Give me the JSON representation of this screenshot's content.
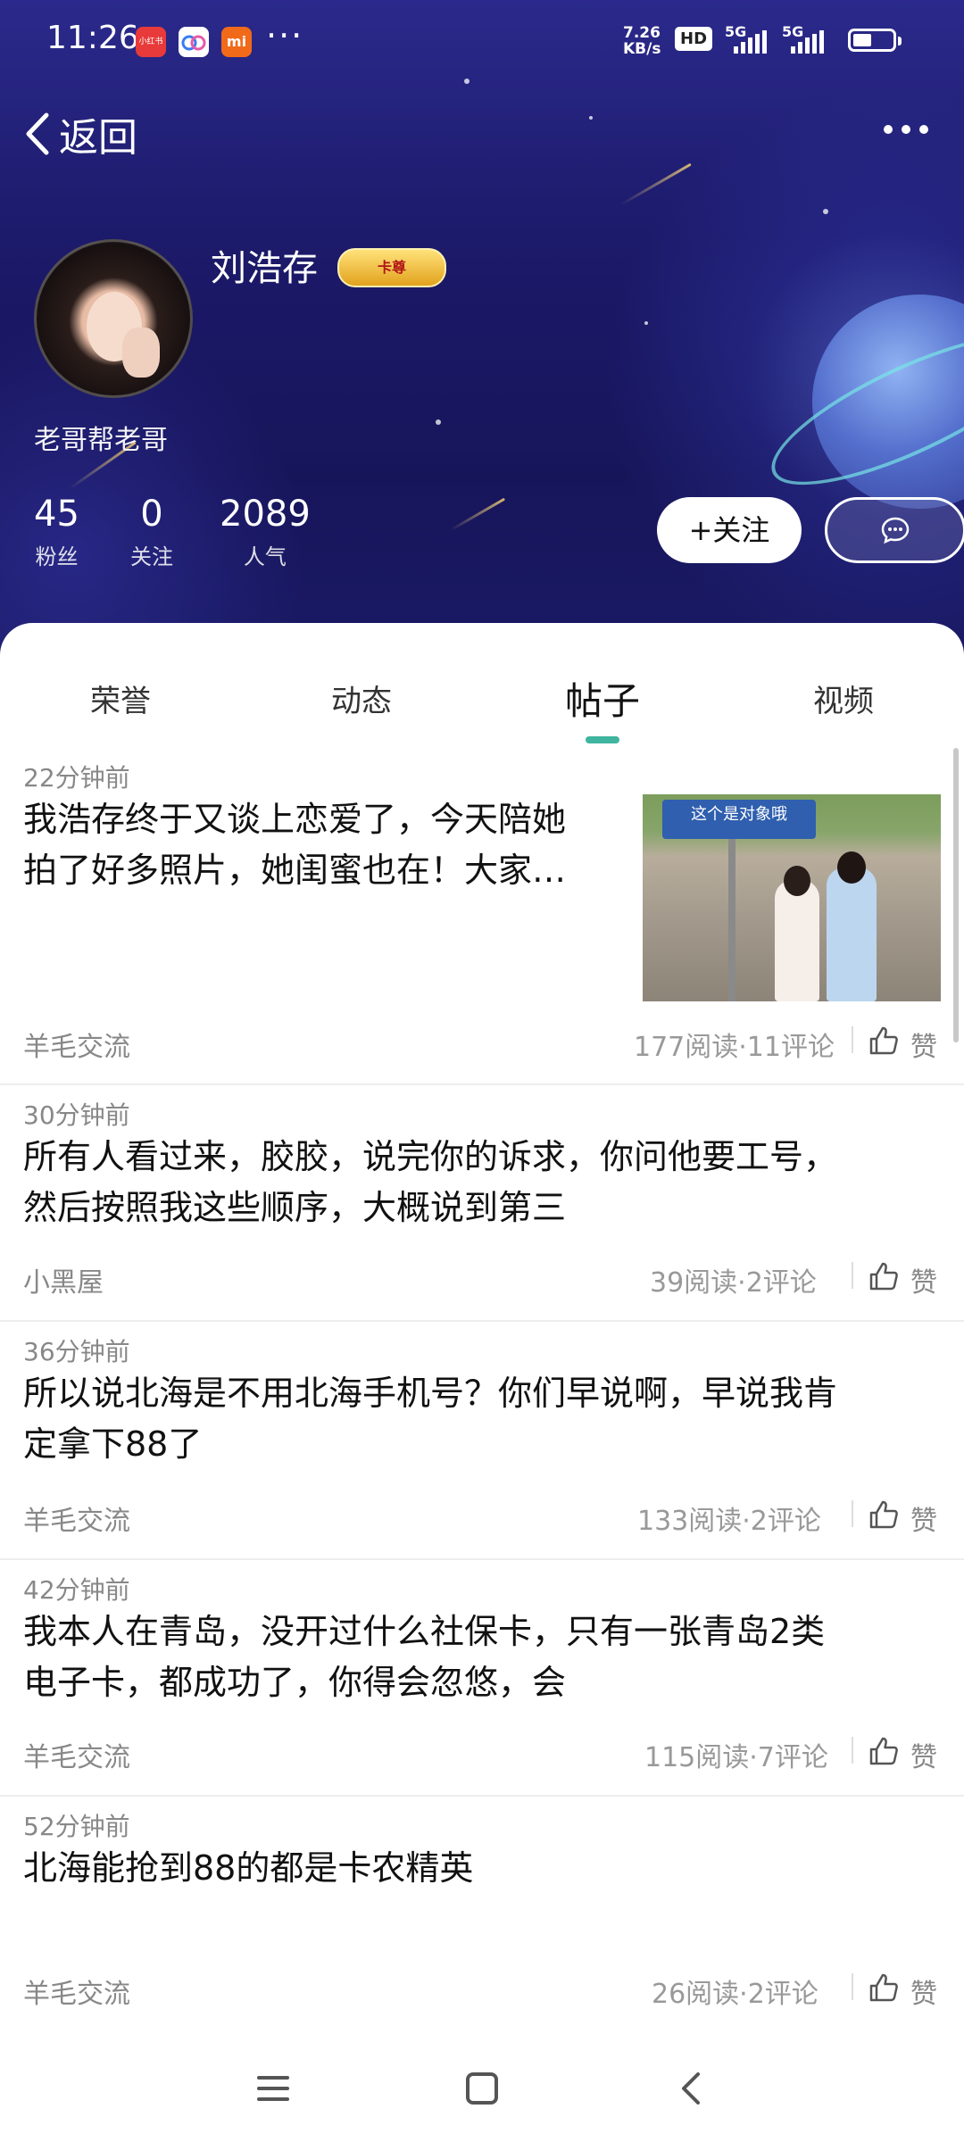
{
  "status_bar": {
    "time": "11:26",
    "app_icons": [
      {
        "name": "xiaohongshu",
        "text": "小红书",
        "color": "#e83a3a"
      },
      {
        "name": "baidu-netdisk",
        "text": "",
        "color": "#ffffff"
      },
      {
        "name": "xiaomi",
        "text": "mi",
        "color": "#f06a1a"
      }
    ],
    "overflow": "···",
    "net_speed": "7.26",
    "net_speed_unit": "KB/s",
    "hd": "HD",
    "net1": "5G",
    "net2": "5G"
  },
  "nav": {
    "back_label": "返回"
  },
  "profile": {
    "username": "刘浩存",
    "badge": "卡尊",
    "bio": "老哥帮老哥",
    "stats": [
      {
        "value": "45",
        "label": "粉丝"
      },
      {
        "value": "0",
        "label": "关注"
      },
      {
        "value": "2089",
        "label": "人气"
      }
    ],
    "follow_label": "+关注"
  },
  "tabs": {
    "items": [
      "荣誉",
      "动态",
      "帖子",
      "视频"
    ],
    "active": "帖子"
  },
  "thumbnail": {
    "sign_text": "这个是对象哦"
  },
  "posts": [
    {
      "time": "22分钟前",
      "lines": [
        "我浩存终于又谈上恋爱了，今天陪她",
        "拍了好多照片，她闺蜜也在！大家…"
      ],
      "category": "羊毛交流",
      "stats": "177阅读·11评论",
      "like": "赞"
    },
    {
      "time": "30分钟前",
      "lines": [
        "所有人看过来，胶胶，说完你的诉求，你问他要工号，",
        "然后按照我这些顺序，大概说到第三"
      ],
      "category": "小黑屋",
      "stats": "39阅读·2评论",
      "like": "赞"
    },
    {
      "time": "36分钟前",
      "lines": [
        "所以说北海是不用北海手机号？你们早说啊，早说我肯",
        "定拿下88了"
      ],
      "category": "羊毛交流",
      "stats": "133阅读·2评论",
      "like": "赞"
    },
    {
      "time": "42分钟前",
      "lines": [
        "我本人在青岛，没开过什么社保卡，只有一张青岛2类",
        "电子卡，都成功了，你得会忽悠，会"
      ],
      "category": "羊毛交流",
      "stats": "115阅读·7评论",
      "like": "赞"
    },
    {
      "time": "52分钟前",
      "lines": [
        "北海能抢到88的都是卡农精英"
      ],
      "category": "羊毛交流",
      "stats": "26阅读·2评论",
      "like": "赞"
    }
  ],
  "colors": {
    "accent": "#3fb59f",
    "header_bg": "#1c1a6a"
  }
}
